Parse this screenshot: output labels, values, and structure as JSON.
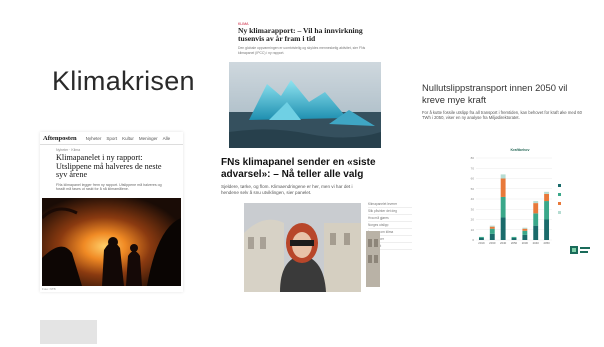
{
  "slide": {
    "title": "Klimakrisen"
  },
  "aftenposten": {
    "logo": "Aftenposten",
    "nav": [
      "Nyheter",
      "Sport",
      "Kultur",
      "Meninger",
      "Alle"
    ],
    "crumbs": "Nyheter · Klima",
    "headline": "Klimapanelet i ny rapport: Utslippene må halveres de neste syv årene",
    "sub": "FNs klimapanel legger frem ny rapport. Utslippene må halveres og fossilt må fases ut raskt for å nå klimamålene.",
    "caption": "Foto: NTB"
  },
  "ice": {
    "kicker": "KLIMA",
    "headline": "Ny klimarapport: – Vil ha innvirkning tusenvis av år fram i tid",
    "sub": "Den globale oppvarmingen er uomtvistelig og skyldes menneskelig aktivitet, sier FNs klimapanel (IPCC) i ny rapport."
  },
  "fn": {
    "headline": "FNs klimapanel sender en «siste advarsel»: – Nå teller alle valg",
    "sub": "Sjeldere, tørke, og flom. Klimaendringene er her, men vi har det i hendene selv å snu utviklingen, sier panelet.",
    "list": [
      "Klimapanelet leverer",
      "Slik påvirker det deg",
      "Hva må gjøres",
      "Norges utslipp",
      "Les mer om klima",
      "Flere saker",
      "Siste nytt"
    ]
  },
  "nullutslipp": {
    "headline": "Nullutslippstransport innen 2050 vil kreve mye kraft",
    "sub": "For å kutte fossile utslipp fra all transport i fremtiden, kan behovet for kraft øke med 60 TWh i 2050, viser en ny analyse fra Miljødirektoratet."
  },
  "chart_data": {
    "type": "bar",
    "title": "Kraftbehov",
    "groups": [
      "",
      ""
    ],
    "categories": [
      "2019",
      "2030",
      "2040",
      "2050",
      "2030",
      "2040",
      "2050"
    ],
    "series": [
      {
        "name": "",
        "color": "#1a6b6b",
        "values": [
          2,
          6,
          22,
          2,
          5,
          14,
          20
        ]
      },
      {
        "name": "",
        "color": "#3aa88a",
        "values": [
          1,
          5,
          20,
          1,
          4,
          12,
          18
        ]
      },
      {
        "name": "",
        "color": "#e8793a",
        "values": [
          0,
          2,
          18,
          0,
          2,
          10,
          7
        ]
      },
      {
        "name": "",
        "color": "#b6dcd2",
        "values": [
          0,
          1,
          4,
          0,
          1,
          2,
          2
        ]
      }
    ],
    "ylim": [
      0,
      80
    ],
    "yticks": [
      0,
      10,
      20,
      30,
      40,
      50,
      60,
      70,
      80
    ],
    "legend": "right",
    "grid": true
  }
}
